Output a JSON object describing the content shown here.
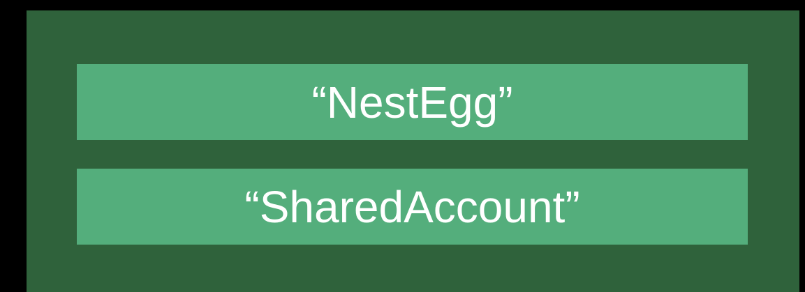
{
  "colors": {
    "background": "#000000",
    "outer_box": "#2f623b",
    "item_box": "#54ae7c",
    "text": "#ffffff"
  },
  "items": [
    {
      "label": "“NestEgg”"
    },
    {
      "label": "“SharedAccount”"
    }
  ]
}
